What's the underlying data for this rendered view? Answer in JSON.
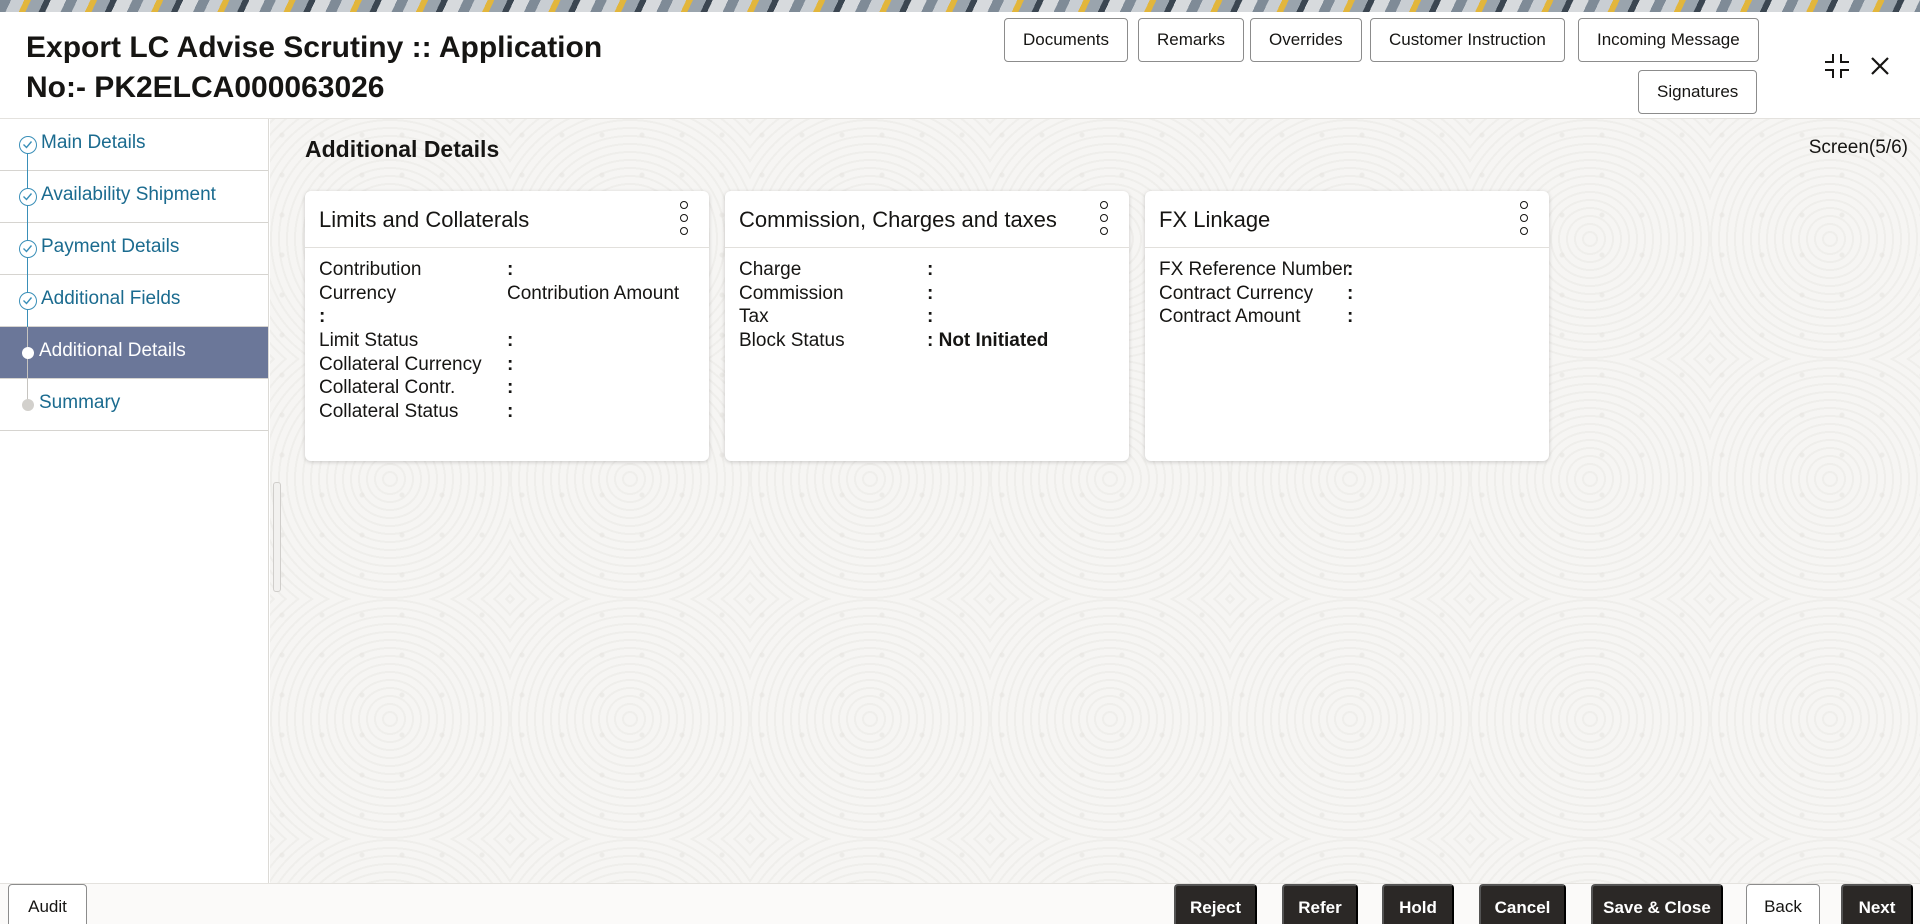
{
  "header": {
    "title": "Export LC Advise Scrutiny :: Application No:- PK2ELCA000063026",
    "buttons": {
      "documents": "Documents",
      "remarks": "Remarks",
      "overrides": "Overrides",
      "customer_instruction": "Customer Instruction",
      "incoming_message": "Incoming Message",
      "signatures": "Signatures"
    },
    "icons": {
      "minimize": "compress-icon",
      "close": "close-icon"
    }
  },
  "sidebar": {
    "items": [
      {
        "label": "Main Details",
        "state": "completed"
      },
      {
        "label": "Availability Shipment",
        "state": "completed"
      },
      {
        "label": "Payment Details",
        "state": "completed"
      },
      {
        "label": "Additional Fields",
        "state": "completed"
      },
      {
        "label": "Additional Details",
        "state": "active"
      },
      {
        "label": "Summary",
        "state": "pending"
      }
    ]
  },
  "main": {
    "section_title": "Additional Details",
    "screen_indicator": "Screen(5/6)",
    "cards": {
      "limits": {
        "title": "Limits and Collaterals",
        "rows": {
          "contribution_currency_k1": "Contribution",
          "contribution_currency_k2": "Currency",
          "contribution_amount_k": "Contribution Amount",
          "limit_status": "Limit Status",
          "collateral_currency": "Collateral Currency",
          "collateral_contr": "Collateral Contr.",
          "collateral_status": "Collateral Status"
        },
        "colon": ":"
      },
      "commission": {
        "title": "Commission, Charges and taxes",
        "rows": {
          "charge": "Charge",
          "commission": "Commission",
          "tax": "Tax",
          "block_status": "Block Status",
          "block_status_value": ": Not Initiated"
        },
        "colon": ":"
      },
      "fx": {
        "title": "FX Linkage",
        "rows": {
          "fx_reference_number": "FX Reference Number",
          "contract_currency": "Contract Currency",
          "contract_amount": "Contract Amount"
        },
        "colon": ":"
      }
    }
  },
  "footer": {
    "audit": "Audit",
    "reject": "Reject",
    "refer": "Refer",
    "hold": "Hold",
    "cancel": "Cancel",
    "save_close": "Save & Close",
    "back": "Back",
    "next": "Next"
  },
  "colors": {
    "accent_step": "#3a8fb8",
    "active_step_bg": "#6b7799",
    "primary_button": "#2b2826"
  }
}
